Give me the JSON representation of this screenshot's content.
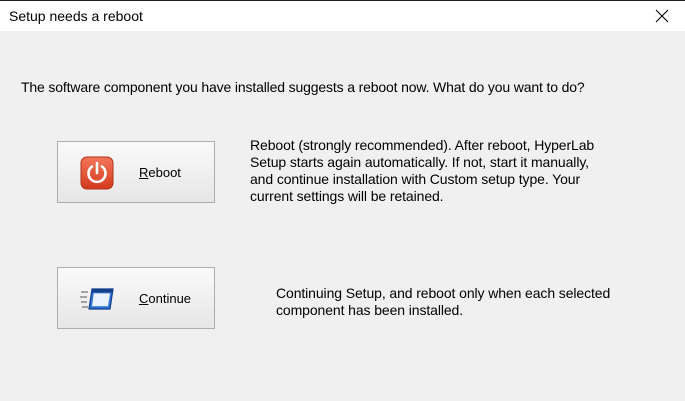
{
  "window": {
    "title": "Setup needs a reboot",
    "close_label": "Close"
  },
  "prompt": "The software component you have installed suggests a reboot now. What do you want to do?",
  "reboot": {
    "accel": "R",
    "label_rest": "eboot",
    "description_lines": [
      "Reboot (strongly recommended). After reboot, HyperLab",
      "Setup starts again automatically. If not, start it manually,",
      "and continue installation with Custom setup type. Your",
      "current settings will be retained."
    ],
    "icon": "power-icon",
    "icon_color": "#e04a2c"
  },
  "continue": {
    "accel": "C",
    "label_rest": "ontinue",
    "description_lines": [
      "Continuing Setup, and reboot only when each selected",
      "component has been installed."
    ],
    "icon": "fast-forward-window-icon",
    "icon_color": "#1e5fbf"
  },
  "colors": {
    "background": "#f0f0f0",
    "titlebar": "#ffffff",
    "button_border": "#adadad"
  }
}
